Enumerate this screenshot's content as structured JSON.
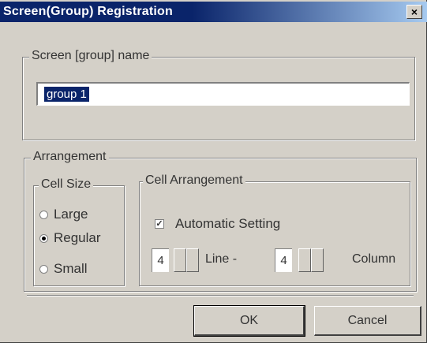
{
  "window": {
    "title": "Screen(Group) Registration",
    "close_glyph": "×"
  },
  "name_group": {
    "legend": "Screen [group] name",
    "input_value": "group 1"
  },
  "arrangement": {
    "legend": "Arrangement",
    "cell_size": {
      "legend": "Cell Size",
      "options": [
        {
          "label": "Large",
          "selected": false
        },
        {
          "label": "Regular",
          "selected": true
        },
        {
          "label": "Small",
          "selected": false
        }
      ]
    },
    "cell_arrangement": {
      "legend": "Cell Arrangement",
      "automatic_setting_label": "Automatic Setting",
      "automatic_setting_checked": true,
      "check_glyph": "✓",
      "line_value": "4",
      "line_label": "Line -",
      "column_value": "4",
      "column_label": "Column"
    }
  },
  "buttons": {
    "ok_label": "OK",
    "cancel_label": "Cancel"
  }
}
